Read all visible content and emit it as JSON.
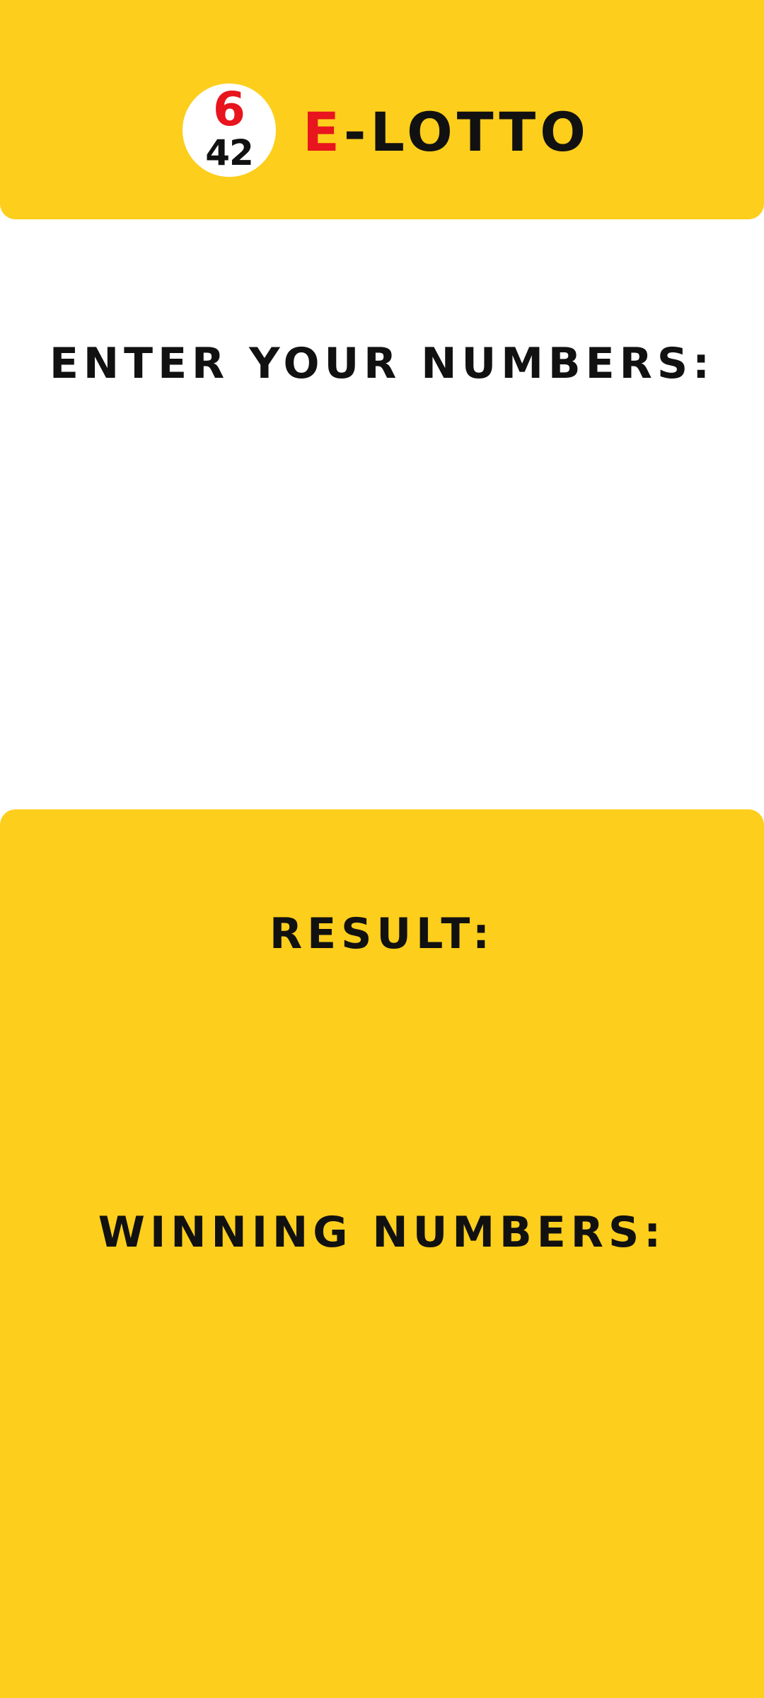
{
  "header": {
    "logo": {
      "top": "6",
      "bottom": "42"
    },
    "title_accent": "E",
    "title_rest": "-LOTTO",
    "colors": {
      "background": "#FDCE1C",
      "accent": "#E8141E",
      "text": "#111111"
    }
  },
  "entry": {
    "heading": "ENTER YOUR NUMBERS:",
    "numbers": []
  },
  "results": {
    "result_heading": "RESULT:",
    "result_value": "",
    "winning_heading": "WINNING NUMBERS:",
    "winning_numbers": []
  }
}
